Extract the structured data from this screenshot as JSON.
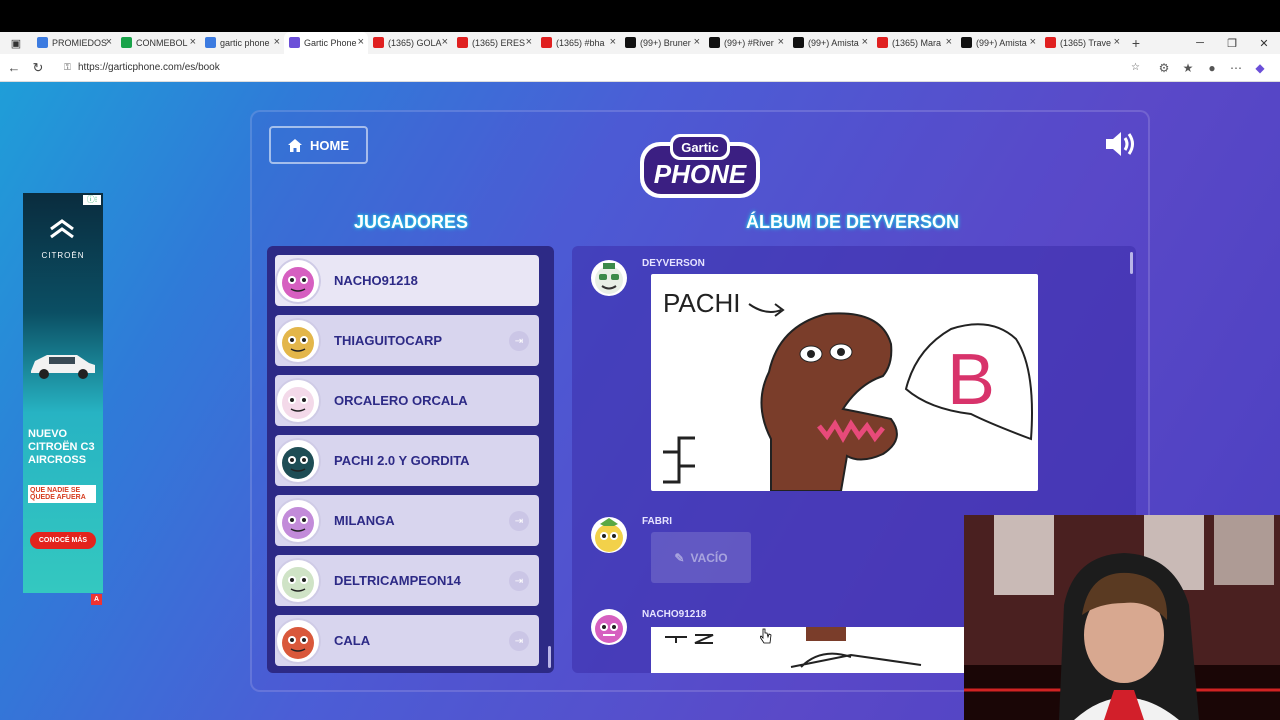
{
  "browser": {
    "tabs": [
      {
        "label": "PROMIEDOS",
        "favicon_color": "#3c7be0"
      },
      {
        "label": "CONMEBOL",
        "favicon_color": "#1aa34a"
      },
      {
        "label": "gartic phone",
        "favicon_color": "#3c7be0"
      },
      {
        "label": "Gartic Phone",
        "favicon_color": "#6b4fd8",
        "active": true
      },
      {
        "label": "(1365) GOLA",
        "favicon_color": "#e02020"
      },
      {
        "label": "(1365) ERES",
        "favicon_color": "#e02020"
      },
      {
        "label": "(1365) #bha",
        "favicon_color": "#e02020"
      },
      {
        "label": "(99+) Bruner",
        "favicon_color": "#111111"
      },
      {
        "label": "(99+) #River",
        "favicon_color": "#111111"
      },
      {
        "label": "(99+) Amista",
        "favicon_color": "#111111"
      },
      {
        "label": "(1365) Mara",
        "favicon_color": "#e02020"
      },
      {
        "label": "(99+) Amista",
        "favicon_color": "#111111"
      },
      {
        "label": "(1365) Trave",
        "favicon_color": "#e02020"
      }
    ],
    "url": "https://garticphone.com/es/book"
  },
  "ad": {
    "brand": "CITROËN",
    "headline": "NUEVO CITROËN C3 AIRCROSS",
    "tagline": "QUE NADIE SE QUEDE AFUERA",
    "cta": "CONOCÉ MÁS",
    "badge": "A"
  },
  "game": {
    "home_label": "HOME",
    "logo_top": "Gartic",
    "logo_bottom": "PHONE",
    "players_title": "JUGADORES",
    "album_title": "ÁLBUM DE DEYVERSON",
    "players": [
      {
        "name": "NACHO91218",
        "color": "#d65fc0",
        "kick": false
      },
      {
        "name": "THIAGUITOCARP",
        "color": "#e3b64a",
        "kick": true
      },
      {
        "name": "ORCALERO ORCALA",
        "color": "#f3d9e9",
        "kick": false
      },
      {
        "name": "PACHI 2.0 Y GORDITA",
        "color": "#1e4d55",
        "kick": false
      },
      {
        "name": "MILANGA",
        "color": "#c28bd9",
        "kick": true
      },
      {
        "name": "DELTRICAMPEON14",
        "color": "#cfe3c6",
        "kick": true
      },
      {
        "name": "CALA",
        "color": "#d9583b",
        "kick": true
      }
    ],
    "album": [
      {
        "author": "DEYVERSON",
        "type": "drawing",
        "drawing_text": "PACHI",
        "speech_letter": "B"
      },
      {
        "author": "FABRI",
        "type": "empty",
        "empty_label": "VACÍO"
      },
      {
        "author": "NACHO91218",
        "type": "drawing"
      }
    ]
  }
}
